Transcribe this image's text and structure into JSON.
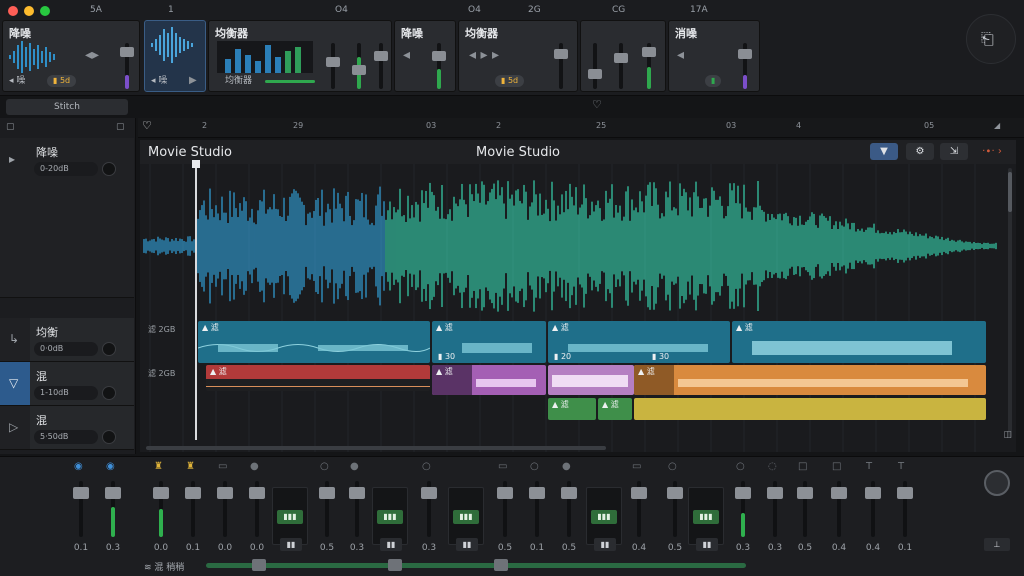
{
  "ruler_top": [
    "5A",
    "1",
    "O4",
    "O4",
    "2G",
    "CG",
    "17A"
  ],
  "effects": [
    {
      "title": "降噪",
      "foot": "◂ 噪",
      "chip": "▮ 5d"
    },
    {
      "title": "",
      "foot": "◂ 噪",
      "chip": ""
    },
    {
      "title": "均衡器",
      "foot": "均衡器",
      "chip": ""
    },
    {
      "title": "降噪",
      "foot": "",
      "chip": ""
    },
    {
      "title": "均衡器",
      "foot": "",
      "chip": "▮ 5d"
    },
    {
      "title": "",
      "foot": "",
      "chip": ""
    },
    {
      "title": "消噪",
      "foot": "",
      "chip": ""
    }
  ],
  "search": {
    "label": "Stitch"
  },
  "ruler": [
    "2",
    "29",
    "03",
    "2",
    "25",
    "03",
    "4",
    "05"
  ],
  "editor": {
    "title_left": "Movie Studio",
    "title_center": "Movie Studio"
  },
  "left_tracks": [
    {
      "name": "降噪",
      "value": "0-20dB"
    },
    {
      "name": "均衡",
      "value": "0·0dB"
    },
    {
      "name": "混",
      "value": "1-10dB"
    },
    {
      "name": "混",
      "value": "5·50dB"
    }
  ],
  "lanes": [
    {
      "label": "滤 2GB"
    },
    {
      "label": "滤 2GB"
    }
  ],
  "clips": {
    "lane1": [
      {
        "label": "▲ 滤",
        "num": ""
      },
      {
        "label": "▲ 滤",
        "num": "▮ 30"
      },
      {
        "label": "▲ 滤",
        "num": "▮ 20"
      },
      {
        "label": "▲ 滤",
        "num": ""
      }
    ],
    "lane2": [
      {
        "label": "▲ 滤"
      },
      {
        "label": "▲ 滤"
      },
      {
        "label": "▲ 滤"
      }
    ],
    "lane3": [
      {
        "label": "▲ 滤"
      },
      {
        "label": "▲ 滤"
      }
    ],
    "extra_nums": [
      "▮ 30"
    ]
  },
  "mixer": {
    "values": [
      "0.1",
      "0.3",
      "0.0",
      "0.1",
      "0.0",
      "0.0",
      "0.5",
      "0.3",
      "0.3",
      "0.5",
      "0.1",
      "0.5",
      "0.4",
      "0.5",
      "0.3",
      "0.3",
      "0.5",
      "0.4",
      "0.4",
      "0.1"
    ],
    "bank_label": "▮▮"
  },
  "bottom": {
    "label": "≋ 混 稍稍"
  }
}
